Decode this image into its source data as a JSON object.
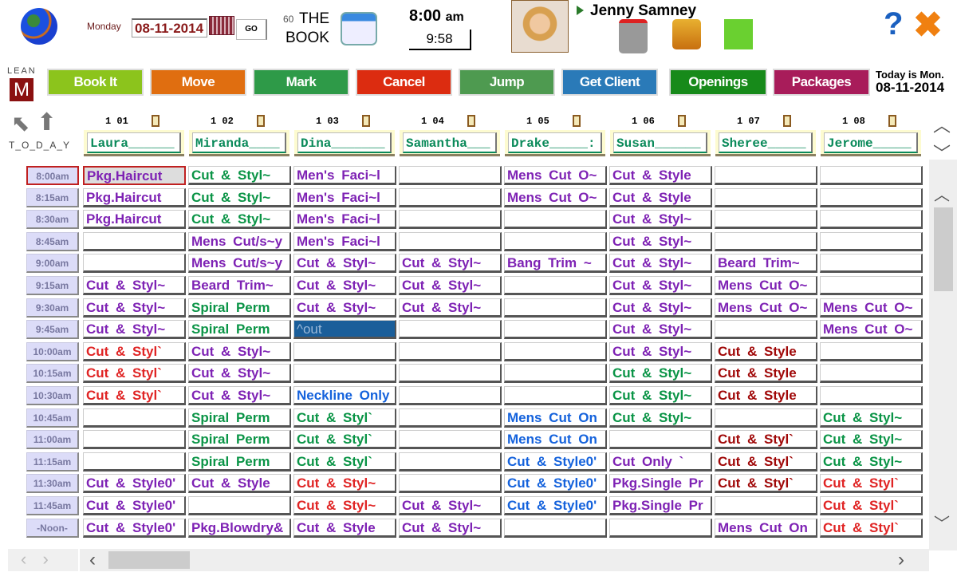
{
  "header": {
    "day": "Monday",
    "date": "08-11-2014",
    "go": "GO",
    "book_prefix": "60",
    "book_line1": "THE",
    "book_line2": "BOOK",
    "time": "8:00",
    "ampm": "am",
    "clock": "9:58",
    "user": "Jenny Samney",
    "today_label": "Today is Mon.",
    "today_date": "08-11-2014",
    "lean": "LEAN",
    "lean_logo": "M",
    "today_nav": "T_O_D_A_Y"
  },
  "toolbar": [
    {
      "label": "Book It",
      "color": "#8cc41c"
    },
    {
      "label": "Move",
      "color": "#e06e10"
    },
    {
      "label": "Mark",
      "color": "#2e9a48"
    },
    {
      "label": "Cancel",
      "color": "#dc2c10"
    },
    {
      "label": "Jump",
      "color": "#4e9a50"
    },
    {
      "label": "Get Client",
      "color": "#2a7ab8"
    },
    {
      "label": "Openings",
      "color": "#178a1a"
    },
    {
      "label": "Packages",
      "color": "#a81c5a"
    }
  ],
  "colors": {
    "p": "#7e22b4",
    "g": "#0a9446",
    "r": "#e02424",
    "d": "#a00808",
    "b": "#1462dc"
  },
  "columns": [
    {
      "num": "1 01",
      "name": "Laura______"
    },
    {
      "num": "1 02",
      "name": "Miranda____"
    },
    {
      "num": "1 03",
      "name": "Dina_______"
    },
    {
      "num": "1 04",
      "name": "Samantha___"
    },
    {
      "num": "1 05",
      "name": "Drake_____:"
    },
    {
      "num": "1 06",
      "name": "Susan______"
    },
    {
      "num": "1 07",
      "name": "Sheree_____"
    },
    {
      "num": "1 08",
      "name": "Jerome_____"
    }
  ],
  "times": [
    "8:00am",
    "8:15am",
    "8:30am",
    "8:45am",
    "9:00am",
    "9:15am",
    "9:30am",
    "9:45am",
    "10:00am",
    "10:15am",
    "10:30am",
    "10:45am",
    "11:00am",
    "11:15am",
    "11:30am",
    "11:45am",
    "-Noon-"
  ],
  "grid": [
    [
      [
        "Pkg.Haircut",
        "p"
      ],
      [
        "Cut & Styl~",
        "g"
      ],
      [
        "Men's Faci~l",
        "p"
      ],
      null,
      [
        "Mens Cut O~",
        "p"
      ],
      [
        "Cut & Style",
        "p"
      ],
      null,
      null
    ],
    [
      [
        "Pkg.Haircut",
        "p"
      ],
      [
        "Cut & Styl~",
        "g"
      ],
      [
        "Men's Faci~l",
        "p"
      ],
      null,
      [
        "Mens Cut O~",
        "p"
      ],
      [
        "Cut & Style",
        "p"
      ],
      null,
      null
    ],
    [
      [
        "Pkg.Haircut",
        "p"
      ],
      [
        "Cut & Styl~",
        "g"
      ],
      [
        "Men's Faci~l",
        "p"
      ],
      null,
      null,
      [
        "Cut & Styl~",
        "p"
      ],
      null,
      null
    ],
    [
      null,
      [
        "Mens Cut/s~y",
        "p"
      ],
      [
        "Men's Faci~l",
        "p"
      ],
      null,
      null,
      [
        "Cut & Styl~",
        "p"
      ],
      null,
      null
    ],
    [
      null,
      [
        "Mens Cut/s~y",
        "p"
      ],
      [
        "Cut & Styl~",
        "p"
      ],
      [
        "Cut & Styl~",
        "p"
      ],
      [
        "Bang Trim ~",
        "p"
      ],
      [
        "Cut & Styl~",
        "p"
      ],
      [
        "Beard Trim~",
        "p"
      ],
      null
    ],
    [
      [
        "Cut & Styl~",
        "p"
      ],
      [
        "Beard Trim~",
        "p"
      ],
      [
        "Cut & Styl~",
        "p"
      ],
      [
        "Cut & Styl~",
        "p"
      ],
      null,
      [
        "Cut & Styl~",
        "p"
      ],
      [
        "Mens Cut O~",
        "p"
      ],
      null
    ],
    [
      [
        "Cut & Styl~",
        "p"
      ],
      [
        "Spiral Perm",
        "g"
      ],
      [
        "Cut & Styl~",
        "p"
      ],
      [
        "Cut & Styl~",
        "p"
      ],
      null,
      [
        "Cut & Styl~",
        "p"
      ],
      [
        "Mens Cut O~",
        "p"
      ],
      [
        "Mens Cut O~",
        "p"
      ]
    ],
    [
      [
        "Cut & Styl~",
        "p"
      ],
      [
        "Spiral Perm",
        "g"
      ],
      [
        "^out",
        "out"
      ],
      null,
      null,
      [
        "Cut & Styl~",
        "p"
      ],
      null,
      [
        "Mens Cut O~",
        "p"
      ]
    ],
    [
      [
        "Cut & Styl`",
        "r"
      ],
      [
        "Cut & Styl~",
        "p"
      ],
      null,
      null,
      null,
      [
        "Cut & Styl~",
        "p"
      ],
      [
        "Cut & Style",
        "d"
      ],
      null
    ],
    [
      [
        "Cut & Styl`",
        "r"
      ],
      [
        "Cut & Styl~",
        "p"
      ],
      null,
      null,
      null,
      [
        "Cut & Styl~",
        "g"
      ],
      [
        "Cut & Style",
        "d"
      ],
      null
    ],
    [
      [
        "Cut & Styl`",
        "r"
      ],
      [
        "Cut & Styl~",
        "p"
      ],
      [
        "Neckline Only",
        "b"
      ],
      null,
      null,
      [
        "Cut & Styl~",
        "g"
      ],
      [
        "Cut & Style",
        "d"
      ],
      null
    ],
    [
      null,
      [
        "Spiral Perm",
        "g"
      ],
      [
        "Cut & Styl`",
        "g"
      ],
      null,
      [
        "Mens Cut On",
        "b"
      ],
      [
        "Cut & Styl~",
        "g"
      ],
      null,
      [
        "Cut & Styl~",
        "g"
      ]
    ],
    [
      null,
      [
        "Spiral Perm",
        "g"
      ],
      [
        "Cut & Styl`",
        "g"
      ],
      null,
      [
        "Mens Cut On",
        "b"
      ],
      null,
      [
        "Cut & Styl`",
        "d"
      ],
      [
        "Cut & Styl~",
        "g"
      ]
    ],
    [
      null,
      [
        "Spiral Perm",
        "g"
      ],
      [
        "Cut & Styl`",
        "g"
      ],
      null,
      [
        "Cut & Style0'",
        "b"
      ],
      [
        "Cut Only  `",
        "p"
      ],
      [
        "Cut & Styl`",
        "d"
      ],
      [
        "Cut & Styl~",
        "g"
      ]
    ],
    [
      [
        "Cut & Style0'",
        "p"
      ],
      [
        "Cut & Style",
        "p"
      ],
      [
        "Cut & Styl~",
        "r"
      ],
      null,
      [
        "Cut & Style0'",
        "b"
      ],
      [
        "Pkg.Single Pr",
        "p"
      ],
      [
        "Cut & Styl`",
        "d"
      ],
      [
        "Cut & Styl`",
        "r"
      ]
    ],
    [
      [
        "Cut & Style0'",
        "p"
      ],
      null,
      [
        "Cut & Styl~",
        "r"
      ],
      [
        "Cut & Styl~",
        "p"
      ],
      [
        "Cut & Style0'",
        "b"
      ],
      [
        "Pkg.Single Pr",
        "p"
      ],
      null,
      [
        "Cut & Styl`",
        "r"
      ]
    ],
    [
      [
        "Cut & Style0'",
        "p"
      ],
      [
        "Pkg.Blowdry&",
        "p"
      ],
      [
        "Cut & Style",
        "p"
      ],
      [
        "Cut & Styl~",
        "p"
      ],
      null,
      null,
      [
        "Mens Cut On",
        "p"
      ],
      [
        "Cut & Styl`",
        "r"
      ]
    ]
  ]
}
